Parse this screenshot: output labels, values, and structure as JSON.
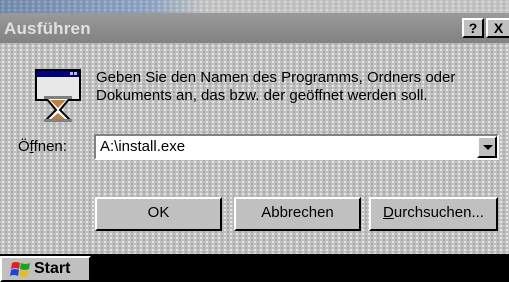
{
  "window": {
    "title": "Ausführen",
    "help_label": "?",
    "close_label": "X"
  },
  "message": "Geben Sie den Namen des Programms, Ordners oder Dokuments an, das bzw. der geöffnet werden soll.",
  "open_field": {
    "label_pre": "Ö",
    "label_accel": "f",
    "label_post": "fnen:",
    "value": "A:\\install.exe"
  },
  "buttons": {
    "ok": "OK",
    "cancel": "Abbrechen",
    "browse_accel": "D",
    "browse_rest": "urchsuchen..."
  },
  "taskbar": {
    "start_label": "Start"
  },
  "icons": {
    "app": "run-program-icon",
    "start": "windows-flag-icon",
    "dropdown": "chevron-down-icon"
  },
  "colors": {
    "dialog_bg": "#c0c0c0",
    "titlebar_inactive": "#8c8c8c",
    "taskbar_bg": "#000000"
  }
}
